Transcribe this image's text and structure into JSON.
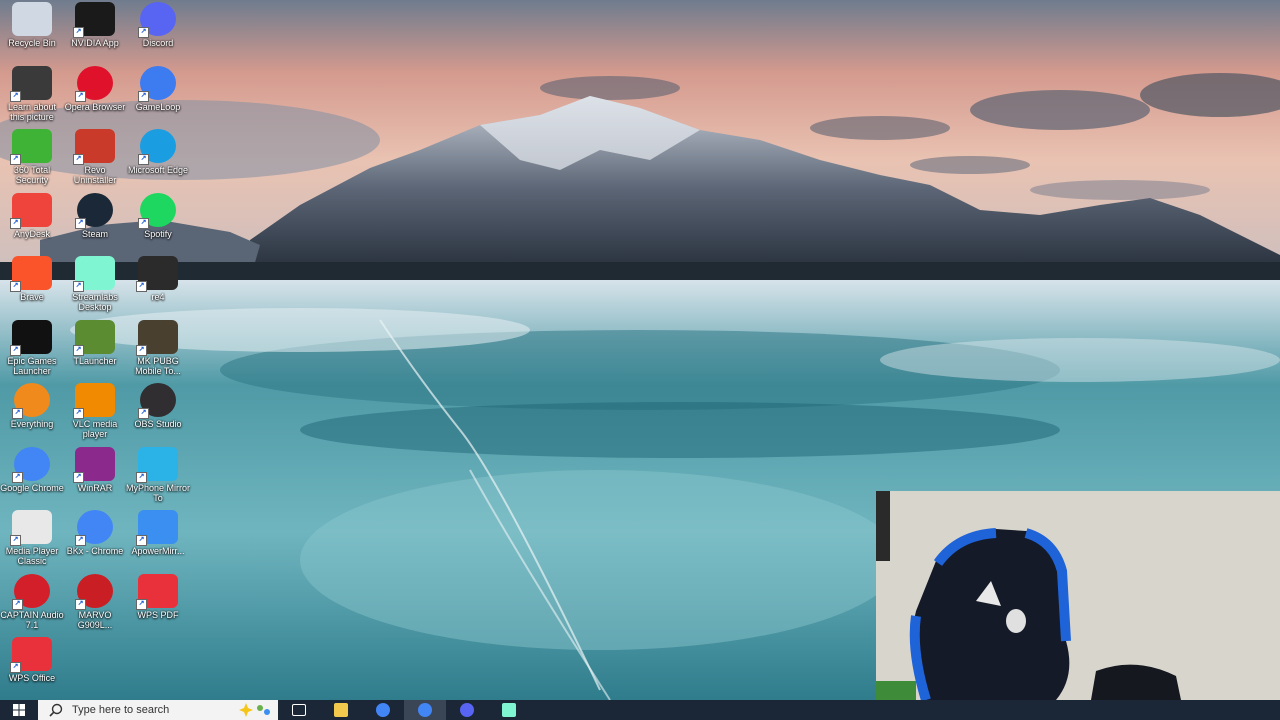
{
  "desktop_icons": [
    {
      "label": "Recycle Bin",
      "icon": "recycle-bin-icon",
      "color": "#cfd8e3"
    },
    {
      "label": "NVIDIA App",
      "icon": "nvidia-icon",
      "color": "#1a1a1a"
    },
    {
      "label": "Discord",
      "icon": "discord-icon",
      "color": "#5865f2"
    },
    {
      "label": "Learn about this picture",
      "icon": "learn-picture-icon",
      "color": "#3a3a3a"
    },
    {
      "label": "Opera Browser",
      "icon": "opera-icon",
      "color": "#e0122b"
    },
    {
      "label": "GameLoop",
      "icon": "gameloop-icon",
      "color": "#3d7bf0"
    },
    {
      "label": "360 Total Security",
      "icon": "360-security-icon",
      "color": "#3fb335"
    },
    {
      "label": "Revo Uninstaller",
      "icon": "revo-uninstaller-icon",
      "color": "#c93a2a"
    },
    {
      "label": "Microsoft Edge",
      "icon": "edge-icon",
      "color": "#1b9de2"
    },
    {
      "label": "AnyDesk",
      "icon": "anydesk-icon",
      "color": "#ef443b"
    },
    {
      "label": "Steam",
      "icon": "steam-icon",
      "color": "#1b2838"
    },
    {
      "label": "Spotify",
      "icon": "spotify-icon",
      "color": "#1ed760"
    },
    {
      "label": "Brave",
      "icon": "brave-icon",
      "color": "#fb542b"
    },
    {
      "label": "Streamlabs Desktop",
      "icon": "streamlabs-icon",
      "color": "#80f5d2"
    },
    {
      "label": "re4",
      "icon": "re4-icon",
      "color": "#2b2b2b"
    },
    {
      "label": "Epic Games Launcher",
      "icon": "epic-games-icon",
      "color": "#111111"
    },
    {
      "label": "TLauncher",
      "icon": "tlauncher-icon",
      "color": "#5b8c32"
    },
    {
      "label": "MK PUBG Mobile To...",
      "icon": "pubg-mobile-icon",
      "color": "#4a4030"
    },
    {
      "label": "Everything",
      "icon": "everything-icon",
      "color": "#f08a1c"
    },
    {
      "label": "VLC media player",
      "icon": "vlc-icon",
      "color": "#f18a00"
    },
    {
      "label": "OBS Studio",
      "icon": "obs-icon",
      "color": "#302e31"
    },
    {
      "label": "Google Chrome",
      "icon": "chrome-icon",
      "color": "#4285f4"
    },
    {
      "label": "WinRAR",
      "icon": "winrar-icon",
      "color": "#8b2a8c"
    },
    {
      "label": "MyPhone Mirror To",
      "icon": "myphone-mirror-icon",
      "color": "#2bb3e8"
    },
    {
      "label": "Media Player Classic",
      "icon": "media-player-classic-icon",
      "color": "#e8e8e8"
    },
    {
      "label": "BKx - Chrome",
      "icon": "chrome-profile-icon",
      "color": "#4285f4"
    },
    {
      "label": "ApowerMirr...",
      "icon": "apowermirror-icon",
      "color": "#3b8ff0"
    },
    {
      "label": "CAPTAIN Audio 7.1",
      "icon": "captain-audio-icon",
      "color": "#d21f2a"
    },
    {
      "label": "MARVO G909L...",
      "icon": "marvo-icon",
      "color": "#c81e24"
    },
    {
      "label": "WPS PDF",
      "icon": "wps-pdf-icon",
      "color": "#e8313b"
    },
    {
      "label": "WPS Office",
      "icon": "wps-office-icon",
      "color": "#e8313b"
    }
  ],
  "taskbar": {
    "search_placeholder": "Type here to search",
    "apps": [
      {
        "name": "task-view-icon",
        "active": false
      },
      {
        "name": "file-explorer-icon",
        "active": false
      },
      {
        "name": "chrome-icon",
        "active": false
      },
      {
        "name": "chrome-profile-icon",
        "active": true
      },
      {
        "name": "discord-taskbar-icon",
        "active": false
      },
      {
        "name": "streamlabs-taskbar-icon",
        "active": false
      }
    ]
  }
}
